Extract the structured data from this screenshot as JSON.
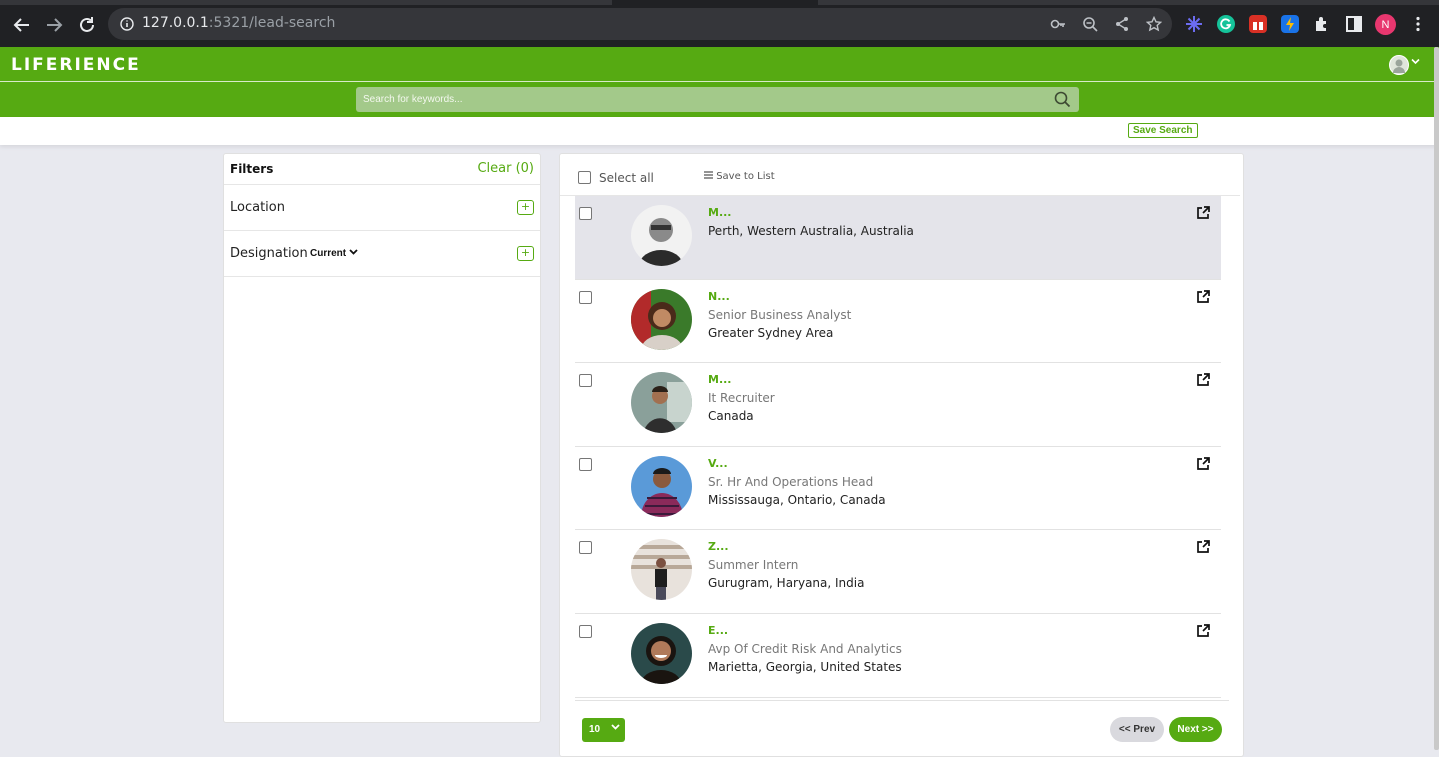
{
  "browser": {
    "url_host": "127.0.0.1",
    "url_rest": ":5321/lead-search",
    "profile_initial": "N"
  },
  "app": {
    "brand": "LIFERIENCE",
    "search_placeholder": "Search for keywords...",
    "save_search": "Save Search"
  },
  "filters": {
    "title": "Filters",
    "clear": "Clear (0)",
    "location": "Location",
    "designation": "Designation",
    "designation_select": "Current",
    "plus": "+"
  },
  "results": {
    "select_all": "Select all",
    "save_to_list": "Save to List",
    "leads": [
      {
        "name": "M...",
        "title": "",
        "location": "Perth, Western Australia, Australia"
      },
      {
        "name": "N...",
        "title": "Senior Business Analyst",
        "location": "Greater Sydney Area"
      },
      {
        "name": "M...",
        "title": "It Recruiter",
        "location": "Canada"
      },
      {
        "name": "V...",
        "title": "Sr. Hr And Operations Head",
        "location": "Mississauga, Ontario, Canada"
      },
      {
        "name": "Z...",
        "title": "Summer Intern",
        "location": "Gurugram, Haryana, India"
      },
      {
        "name": "E...",
        "title": "Avp Of Credit Risk And Analytics",
        "location": "Marietta, Georgia, United States"
      }
    ],
    "per_page": "10",
    "prev": "<< Prev",
    "next": "Next >>"
  },
  "colors": {
    "brand_green": "#56aa12",
    "active_row": "#e4e4ea"
  }
}
